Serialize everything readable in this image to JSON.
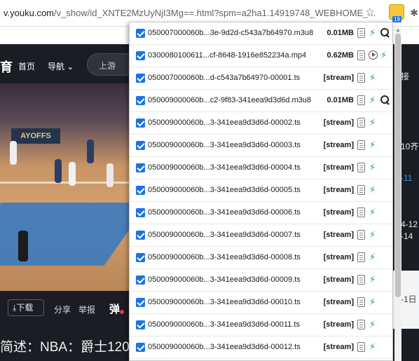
{
  "browser": {
    "url_main": "v.youku.com",
    "url_path": "/v_show/id_XNTE2MzUyNjI3Mg==.html?spm=a2ha1.14919748_WEBHOME_...",
    "extension_badge": "19",
    "icons": [
      "share-icon",
      "star-icon",
      "extension-icon",
      "puzzle-icon",
      "reading-list-icon"
    ]
  },
  "site": {
    "logo": "育",
    "nav": [
      "首页",
      "导航"
    ],
    "search_placeholder": "上游",
    "video_banner": "AYOFFS",
    "download_label": "下载",
    "share_label": "分享",
    "report_label": "举报",
    "danmu_label": "弹",
    "description": "简述：NBA：爵士120",
    "right_texts": [
      "接",
      "10齐",
      "-11",
      "4-12",
      "-14",
      "-1日"
    ]
  },
  "popup": {
    "rows": [
      {
        "name": "050007000060b...3e-9d2d-c543a7b64970.m3u8",
        "size": "0.01MB",
        "type": "m3u8"
      },
      {
        "name": "0300080100611...cf-8648-1916e852234a.mp4",
        "size": "0.62MB",
        "type": "mp4"
      },
      {
        "name": "050007000060b...d-c543a7b64970-00001.ts",
        "size": "[stream]",
        "type": "ts"
      },
      {
        "name": "050009000060b...c2-9f83-341eea9d3d6d.m3u8",
        "size": "0.01MB",
        "type": "m3u8"
      },
      {
        "name": "050009000060b...3-341eea9d3d6d-00002.ts",
        "size": "[stream]",
        "type": "ts"
      },
      {
        "name": "050009000060b...3-341eea9d3d6d-00003.ts",
        "size": "[stream]",
        "type": "ts"
      },
      {
        "name": "050009000060b...3-341eea9d3d6d-00004.ts",
        "size": "[stream]",
        "type": "ts"
      },
      {
        "name": "050009000060b...3-341eea9d3d6d-00005.ts",
        "size": "[stream]",
        "type": "ts"
      },
      {
        "name": "050009000060b...3-341eea9d3d6d-00006.ts",
        "size": "[stream]",
        "type": "ts"
      },
      {
        "name": "050009000060b...3-341eea9d3d6d-00007.ts",
        "size": "[stream]",
        "type": "ts"
      },
      {
        "name": "050009000060b...3-341eea9d3d6d-00008.ts",
        "size": "[stream]",
        "type": "ts"
      },
      {
        "name": "050009000060b...3-341eea9d3d6d-00009.ts",
        "size": "[stream]",
        "type": "ts"
      },
      {
        "name": "050009000060b...3-341eea9d3d6d-00010.ts",
        "size": "[stream]",
        "type": "ts"
      },
      {
        "name": "050009000060b...3-341eea9d3d6d-00011.ts",
        "size": "[stream]",
        "type": "ts"
      },
      {
        "name": "050009000060b...3-341eea9d3d6d-00012.ts",
        "size": "[stream]",
        "type": "ts"
      }
    ]
  },
  "colors": {
    "checkbox": "#1a73e8",
    "download_arrow": "#18a558",
    "page_dark": "#1a1d23"
  }
}
